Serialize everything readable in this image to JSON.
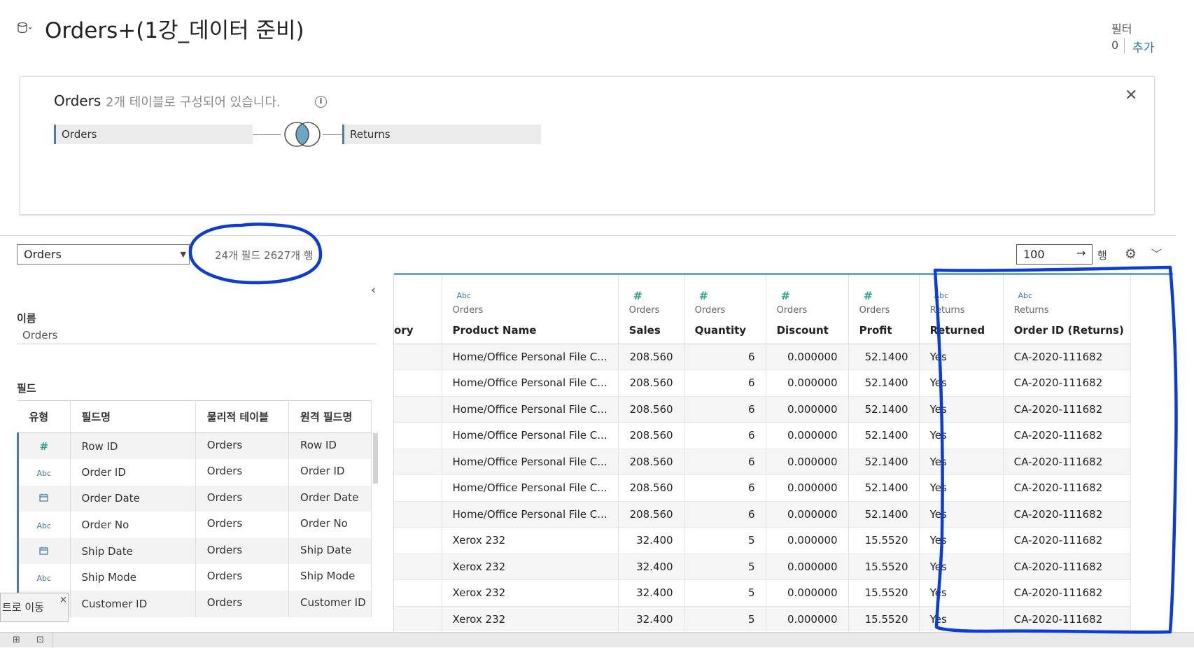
{
  "header": {
    "title": "Orders+(1강_데이터 준비)",
    "filter_label": "필터",
    "filter_count": "0",
    "filter_add": "추가"
  },
  "relationship": {
    "title": "Orders",
    "description": "2개 테이블로 구성되어 있습니다.",
    "left_table": "Orders",
    "right_table": "Returns",
    "info_glyph": "i",
    "close_glyph": "✕"
  },
  "toolbar": {
    "table_select": "Orders",
    "field_row_count": "24개 필드 2627개 행",
    "rows_value": "100",
    "rows_unit": "행"
  },
  "meta_panel": {
    "name_label": "이름",
    "name_value": "Orders",
    "fields_label": "필드",
    "columns": [
      "유형",
      "필드명",
      "물리적 테이블",
      "원격 필드명"
    ],
    "rows": [
      {
        "type": "hash",
        "glyph": "#",
        "field": "Row ID",
        "table": "Orders",
        "remote": "Row ID"
      },
      {
        "type": "abc",
        "glyph": "Abc",
        "field": "Order ID",
        "table": "Orders",
        "remote": "Order ID"
      },
      {
        "type": "date",
        "glyph": "📅",
        "field": "Order Date",
        "table": "Orders",
        "remote": "Order Date"
      },
      {
        "type": "abc",
        "glyph": "Abc",
        "field": "Order No",
        "table": "Orders",
        "remote": "Order No"
      },
      {
        "type": "date",
        "glyph": "📅",
        "field": "Ship Date",
        "table": "Orders",
        "remote": "Ship Date"
      },
      {
        "type": "abc",
        "glyph": "Abc",
        "field": "Ship Mode",
        "table": "Orders",
        "remote": "Ship Mode"
      },
      {
        "type": "abc",
        "glyph": "Abc",
        "field": "Customer ID",
        "table": "Orders",
        "remote": "Customer ID"
      }
    ],
    "toast_text": "트로 이동",
    "toast_close": "×"
  },
  "grid": {
    "columns": [
      {
        "icon": "",
        "source": "",
        "name": "ory"
      },
      {
        "icon": "Abc",
        "source": "Orders",
        "name": "Product Name"
      },
      {
        "icon": "#",
        "source": "Orders",
        "name": "Sales"
      },
      {
        "icon": "#",
        "source": "Orders",
        "name": "Quantity"
      },
      {
        "icon": "#",
        "source": "Orders",
        "name": "Discount"
      },
      {
        "icon": "#",
        "source": "Orders",
        "name": "Profit"
      },
      {
        "icon": "Abc",
        "source": "Returns",
        "name": "Returned"
      },
      {
        "icon": "Abc",
        "source": "Returns",
        "name": "Order ID (Returns)"
      }
    ],
    "rows": [
      [
        "",
        "Home/Office Personal File C...",
        "208.560",
        "6",
        "0.000000",
        "52.1400",
        "Yes",
        "CA-2020-111682"
      ],
      [
        "",
        "Home/Office Personal File C...",
        "208.560",
        "6",
        "0.000000",
        "52.1400",
        "Yes",
        "CA-2020-111682"
      ],
      [
        "",
        "Home/Office Personal File C...",
        "208.560",
        "6",
        "0.000000",
        "52.1400",
        "Yes",
        "CA-2020-111682"
      ],
      [
        "",
        "Home/Office Personal File C...",
        "208.560",
        "6",
        "0.000000",
        "52.1400",
        "Yes",
        "CA-2020-111682"
      ],
      [
        "",
        "Home/Office Personal File C...",
        "208.560",
        "6",
        "0.000000",
        "52.1400",
        "Yes",
        "CA-2020-111682"
      ],
      [
        "",
        "Home/Office Personal File C...",
        "208.560",
        "6",
        "0.000000",
        "52.1400",
        "Yes",
        "CA-2020-111682"
      ],
      [
        "",
        "Home/Office Personal File C...",
        "208.560",
        "6",
        "0.000000",
        "52.1400",
        "Yes",
        "CA-2020-111682"
      ],
      [
        "",
        "Xerox 232",
        "32.400",
        "5",
        "0.000000",
        "15.5520",
        "Yes",
        "CA-2020-111682"
      ],
      [
        "",
        "Xerox 232",
        "32.400",
        "5",
        "0.000000",
        "15.5520",
        "Yes",
        "CA-2020-111682"
      ],
      [
        "",
        "Xerox 232",
        "32.400",
        "5",
        "0.000000",
        "15.5520",
        "Yes",
        "CA-2020-111682"
      ],
      [
        "",
        "Xerox 232",
        "32.400",
        "5",
        "0.000000",
        "15.5520",
        "Yes",
        "CA-2020-111682"
      ]
    ]
  },
  "icons": {
    "datasource": "datasource-icon",
    "info": "info-icon",
    "close": "close-icon",
    "join": "inner-join-icon",
    "dropdown": "chevron-down-icon",
    "arrow": "arrow-right-icon",
    "gear": "gear-icon",
    "collapse": "chevron-left-icon"
  },
  "colors": {
    "accent": "#1f77b4",
    "chip_border": "#4e79a7",
    "number_type": "#2aa58a",
    "string_type": "#3c78b4",
    "join_fill": "#6aa8c4",
    "annotation": "#0a3cdc"
  }
}
